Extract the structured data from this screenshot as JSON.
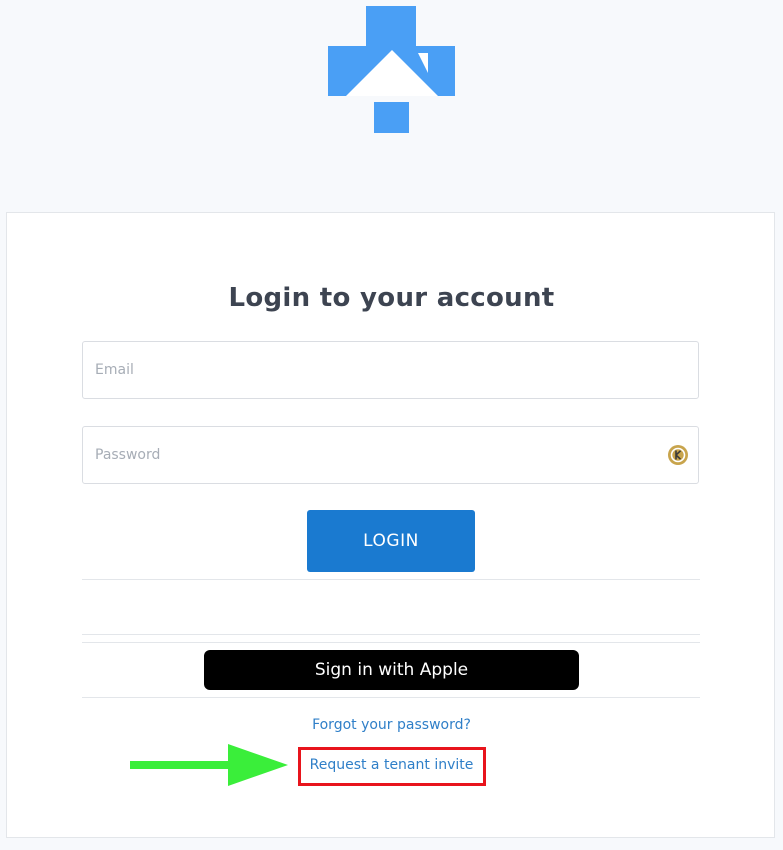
{
  "logo": {
    "icon": "house-icon",
    "color": "#4a9ff5"
  },
  "login": {
    "title": "Login to your account",
    "email_placeholder": "Email",
    "password_placeholder": "Password",
    "password_manager_icon": "keeper-icon",
    "login_label": "LOGIN"
  },
  "apple": {
    "label": "Sign in with Apple"
  },
  "links": {
    "forgot": "Forgot your password?",
    "invite": "Request a tenant invite"
  },
  "annotations": {
    "highlight_color": "#e8141c",
    "arrow_color": "#3aee3a",
    "arrow_icon": "right-arrow-icon"
  },
  "colors": {
    "primary": "#1a7ad0",
    "link": "#2f7fc8",
    "background": "#f7f9fc"
  }
}
